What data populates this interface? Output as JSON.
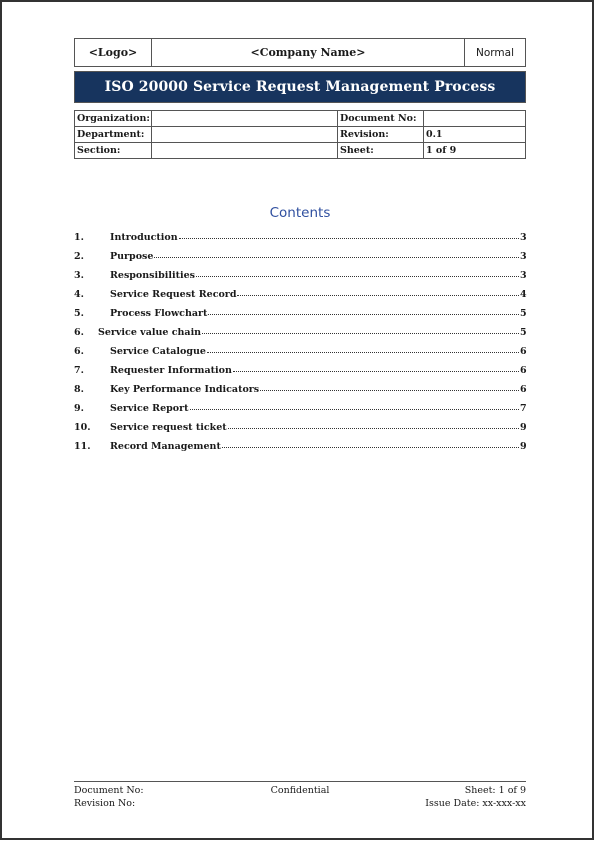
{
  "header": {
    "logo": "<Logo>",
    "company": "<Company Name>",
    "classification": "Normal"
  },
  "title": "ISO 20000 Service Request Management Process",
  "colors": {
    "title_bar": "#17345e",
    "contents_heading": "#2f4f9f"
  },
  "info": {
    "organization_label": "Organization:",
    "organization_value": "",
    "document_no_label": "Document No:",
    "document_no_value": "",
    "department_label": "Department:",
    "department_value": "",
    "revision_label": "Revision:",
    "revision_value": "0.1",
    "section_label": "Section:",
    "section_value": "",
    "sheet_label": "Sheet:",
    "sheet_value": "1 of 9"
  },
  "contents": {
    "heading": "Contents",
    "items": [
      {
        "num": "1.",
        "label": "Introduction",
        "page": "3"
      },
      {
        "num": "2.",
        "label": "Purpose",
        "page": "3"
      },
      {
        "num": "3.",
        "label": "Responsibilities",
        "page": "3"
      },
      {
        "num": "4.",
        "label": "Service Request Record",
        "page": "4"
      },
      {
        "num": "5.",
        "label": "Process Flowchart",
        "page": "5"
      },
      {
        "num": "6.",
        "label": "Service value chain",
        "page": "5"
      },
      {
        "num": "6.",
        "label": "Service Catalogue",
        "page": "6"
      },
      {
        "num": "7.",
        "label": "Requester Information",
        "page": "6"
      },
      {
        "num": "8.",
        "label": "Key Performance Indicators",
        "page": "6"
      },
      {
        "num": "9.",
        "label": "Service Report",
        "page": "7"
      },
      {
        "num": "10.",
        "label": "Service request ticket",
        "page": "9"
      },
      {
        "num": "11.",
        "label": "Record Management",
        "page": "9"
      }
    ]
  },
  "footer": {
    "document_no": "Document No:",
    "confidential": "Confidential",
    "sheet": "Sheet: 1 of 9",
    "revision_no": "Revision No:",
    "issue_date": "Issue Date: xx-xxx-xx"
  }
}
